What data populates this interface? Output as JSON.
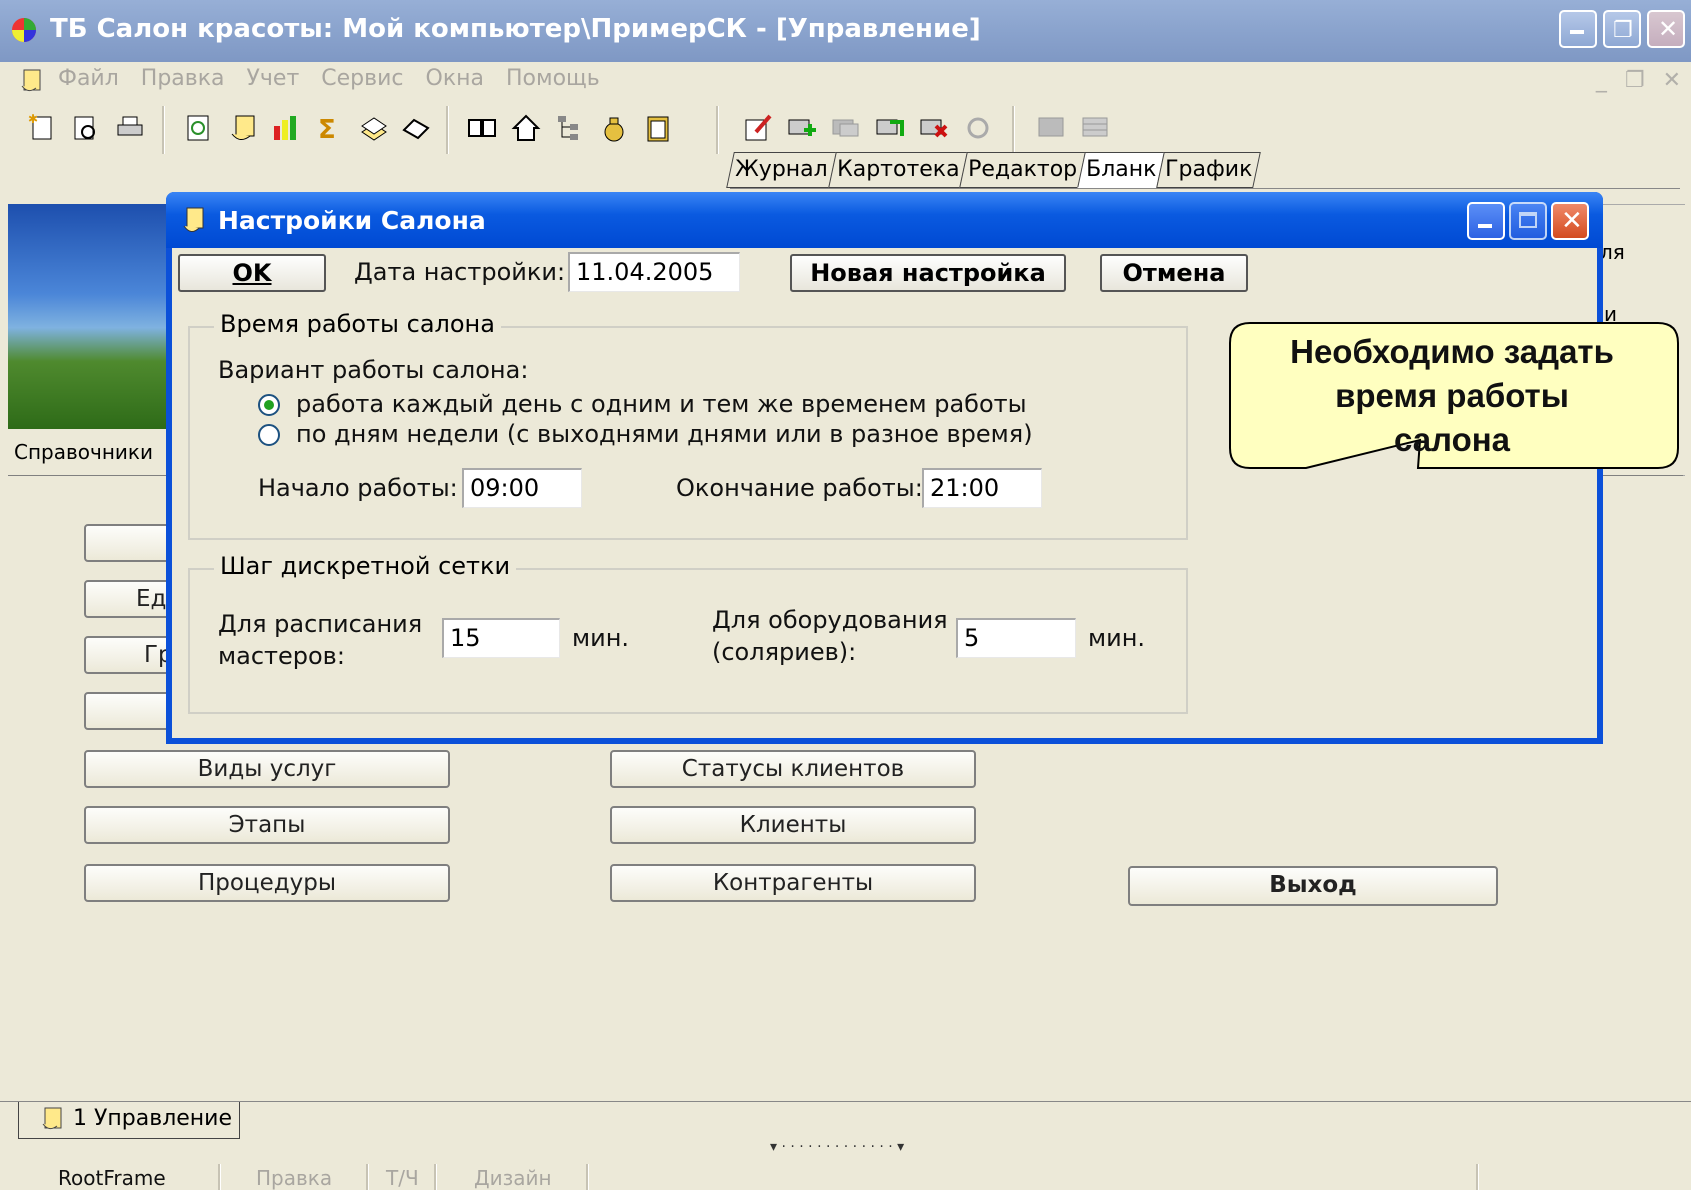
{
  "window": {
    "title": "ТБ Салон красоты: Мой компьютер\\ПримерСК - [Управление]"
  },
  "menu": {
    "items": [
      "Файл",
      "Правка",
      "Учет",
      "Сервис",
      "Окна",
      "Помощь"
    ]
  },
  "tabs_top": [
    "Журнал",
    "Картотека",
    "Редактор",
    "Бланк",
    "График"
  ],
  "tabs_top_active": "Бланк",
  "background": {
    "section_label": "Справочники",
    "right_fragment_1": "ля",
    "right_fragment_2": "и",
    "partial_buttons": [
      "",
      "Ед",
      "Гр",
      ""
    ],
    "buttons_left": [
      "Виды услуг",
      "Этапы",
      "Процедуры"
    ],
    "buttons_mid": [
      "Статусы клиентов",
      "Клиенты",
      "Контрагенты"
    ],
    "exit_button": "Выход"
  },
  "bottom_tab": "1 Управление",
  "statusbar": [
    "RootFrame",
    "Правка",
    "Т/Ч",
    "Дизайн"
  ],
  "dialog": {
    "title": "Настройки Салона",
    "ok_label": "OK",
    "date_label": "Дата настройки:",
    "date_value": "11.04.2005",
    "new_setting_label": "Новая настройка",
    "cancel_label": "Отмена",
    "group_work_time": {
      "legend": "Время работы салона",
      "variant_label": "Вариант работы салона:",
      "option_same": "работа каждый день с одним и тем же временем работы",
      "option_by_day": "по дням недели (с выходнями днями или в разное время)",
      "selected": "option_same",
      "start_label": "Начало работы:",
      "start_value": "09:00",
      "end_label": "Окончание работы:",
      "end_value": "21:00"
    },
    "group_grid": {
      "legend": "Шаг дискретной сетки",
      "masters_label_1": "Для расписания",
      "masters_label_2": "мастеров:",
      "masters_value": "15",
      "masters_unit": "мин.",
      "equip_label_1": "Для оборудования",
      "equip_label_2": "(соляриев):",
      "equip_value": "5",
      "equip_unit": "мин."
    }
  },
  "callout": {
    "lines": [
      "Необходимо задать",
      "время работы",
      "салона"
    ],
    "fill": "#ffffc0",
    "stroke": "#000000"
  },
  "colors": {
    "dialog_titlebar": "#0054e3",
    "window_titlebar": "#8aa3cd",
    "window_bg": "#ece9d8"
  }
}
